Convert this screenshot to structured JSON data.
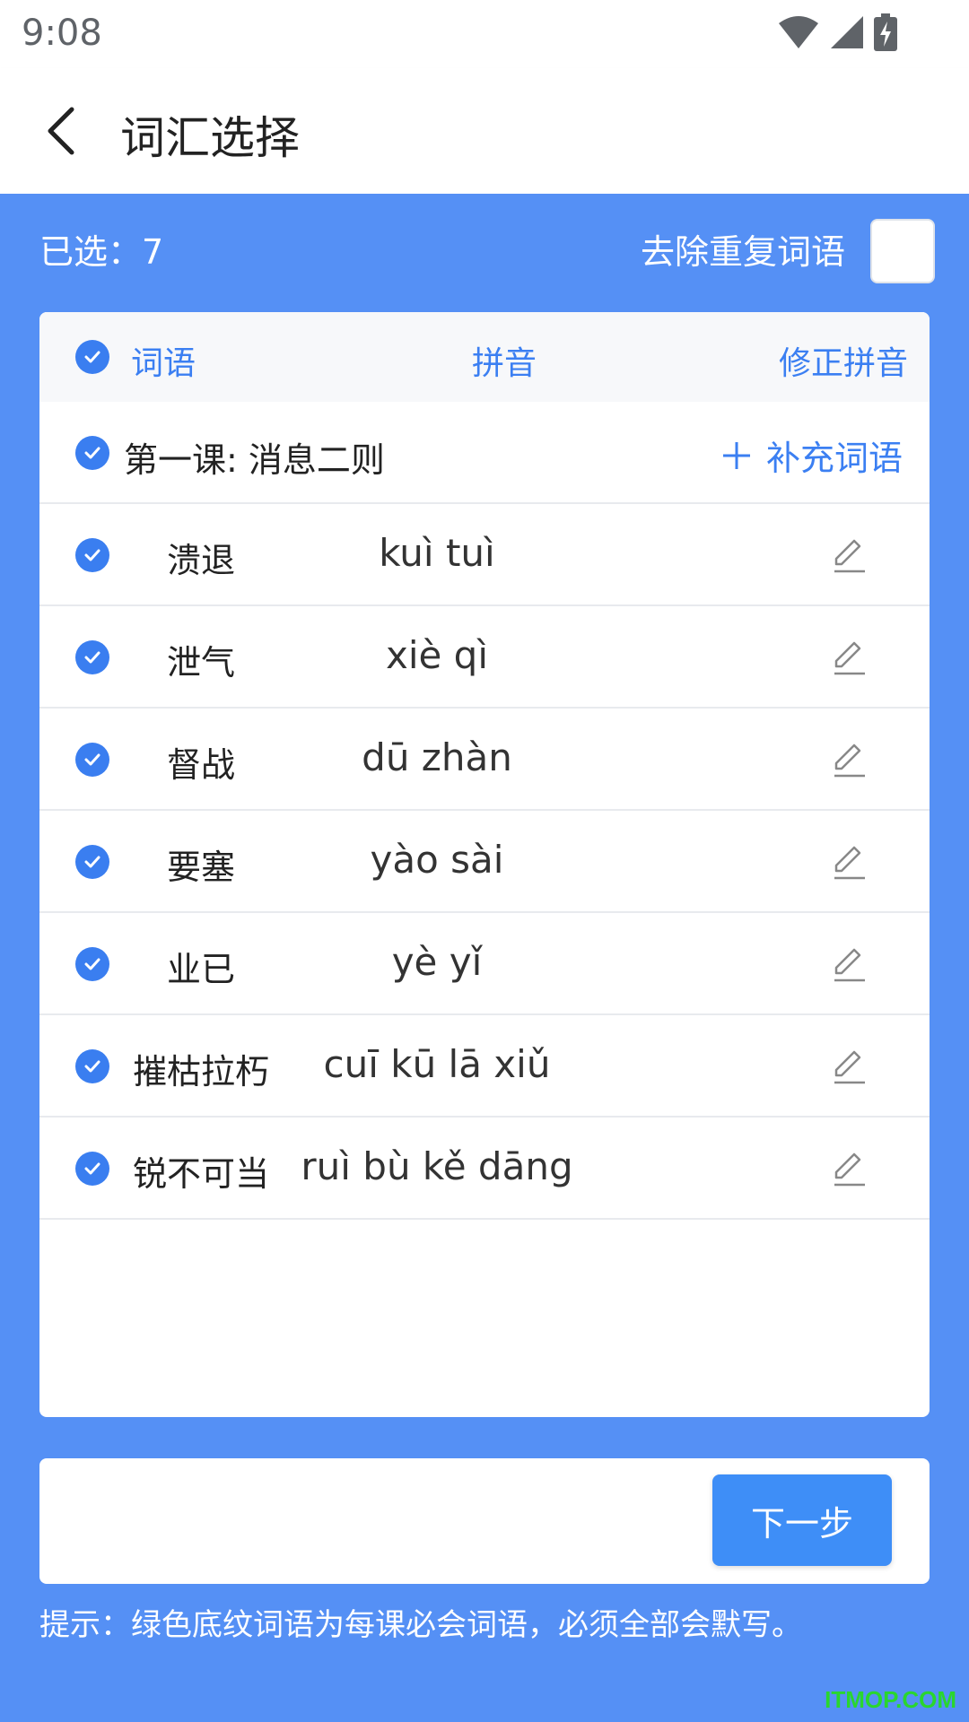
{
  "status_bar": {
    "time": "9:08"
  },
  "header": {
    "title": "词汇选择"
  },
  "summary": {
    "selected_label": "已选：7",
    "dedupe_label": "去除重复词语"
  },
  "table": {
    "columns": {
      "word": "词语",
      "pinyin": "拼音",
      "fix": "修正拼音"
    },
    "lesson": {
      "title": "第一课: 消息二则",
      "add_label": "补充词语"
    },
    "rows": [
      {
        "word": "溃退",
        "pinyin": "kuì tuì"
      },
      {
        "word": "泄气",
        "pinyin": "xiè qì"
      },
      {
        "word": "督战",
        "pinyin": "dū zhàn"
      },
      {
        "word": "要塞",
        "pinyin": "yào sài"
      },
      {
        "word": "业已",
        "pinyin": "yè yǐ"
      },
      {
        "word": "摧枯拉朽",
        "pinyin": "cuī kū lā xiǔ"
      },
      {
        "word": "锐不可当",
        "pinyin": "ruì bù kě dāng"
      }
    ]
  },
  "footer": {
    "next_label": "下一步",
    "hint": "提示：绿色底纹词语为每课必会词语，必须全部会默写。"
  },
  "watermark": "ITMOP.COM",
  "colors": {
    "primary_bg": "#5590F5",
    "accent": "#3b7ff2",
    "button": "#3e8ef7"
  },
  "icons": [
    "wifi-icon",
    "signal-icon",
    "battery-charging-icon",
    "back-arrow-icon",
    "check-circle-icon",
    "plus-icon",
    "edit-pencil-icon"
  ]
}
